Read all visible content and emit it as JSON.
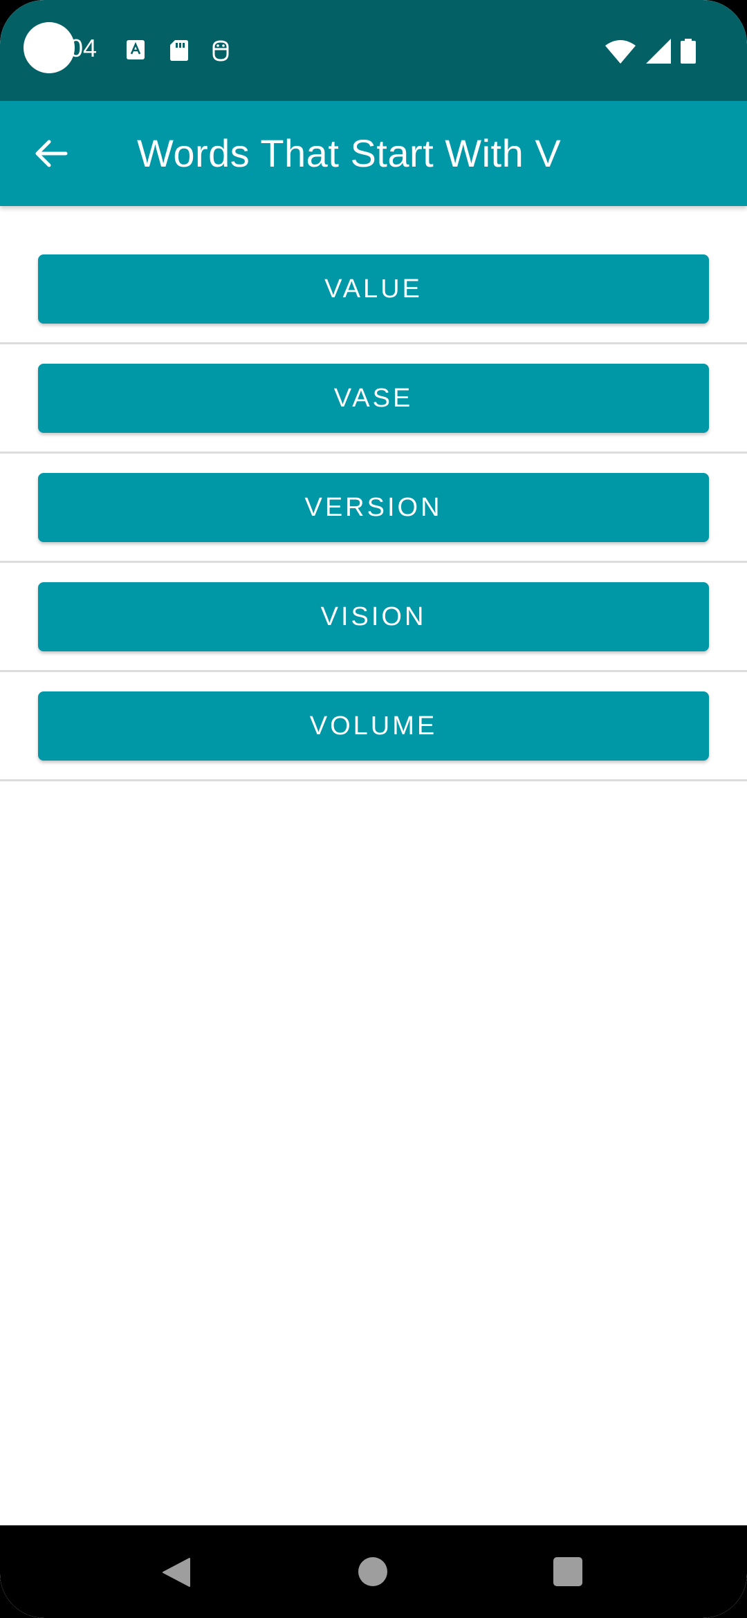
{
  "status_bar": {
    "time": "04",
    "background": "#036166",
    "left_icons": [
      "font-download-icon",
      "sd-card-icon",
      "android-debug-icon"
    ],
    "right_icons": [
      "wifi-icon",
      "cellular-signal-icon",
      "battery-icon"
    ]
  },
  "app_bar": {
    "title": "Words That Start With V",
    "back_icon": "arrow-back-icon",
    "background": "#0097a7"
  },
  "words": [
    {
      "label": "VALUE"
    },
    {
      "label": "VASE"
    },
    {
      "label": "VERSION"
    },
    {
      "label": "VISION"
    },
    {
      "label": "VOLUME"
    }
  ],
  "nav_bar": {
    "buttons": [
      "back-icon",
      "home-icon",
      "recents-icon"
    ]
  }
}
